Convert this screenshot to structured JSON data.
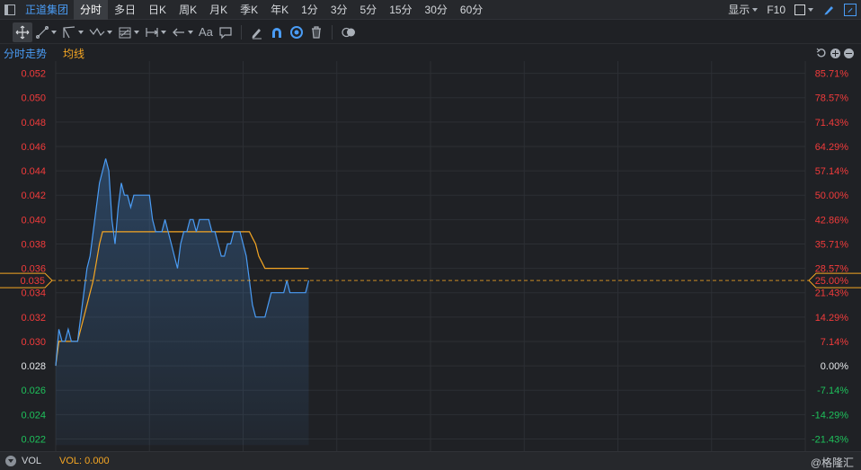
{
  "topbar": {
    "stock_name": "正道集团",
    "tabs": [
      "分时",
      "多日",
      "日K",
      "周K",
      "月K",
      "季K",
      "年K",
      "1分",
      "3分",
      "5分",
      "15分",
      "30分",
      "60分"
    ],
    "active_tab": 0,
    "display_label": "显示",
    "f10_label": "F10"
  },
  "toolbar": {
    "text_tool_label": "Aa"
  },
  "chart_head": {
    "time_share_label": "分时走势",
    "avg_label": "均线"
  },
  "colors": {
    "up": "#f23b3b",
    "down": "#1ec15b",
    "price_line": "#4a9cf5",
    "avg_line": "#f5a623",
    "accent": "#4a9cf5"
  },
  "chart_data": {
    "type": "line",
    "prev_close": 0.028,
    "current_price": "0.035",
    "current_pct": "25.00%",
    "ylim": [
      0.021,
      0.053
    ],
    "left_ticks": [
      "0.052",
      "0.050",
      "0.048",
      "0.046",
      "0.044",
      "0.042",
      "0.040",
      "0.038",
      "0.036",
      "0.034",
      "0.032",
      "0.030",
      "0.028",
      "0.026",
      "0.024",
      "0.022"
    ],
    "right_ticks": [
      "85.71%",
      "78.57%",
      "71.43%",
      "64.29%",
      "57.14%",
      "50.00%",
      "42.86%",
      "35.71%",
      "28.57%",
      "21.43%",
      "14.29%",
      "7.14%",
      "0.00%",
      "-7.14%",
      "-14.29%",
      "-21.43%"
    ],
    "total_minutes": 240,
    "series": [
      {
        "name": "分时走势",
        "values": [
          0.028,
          0.031,
          0.03,
          0.03,
          0.031,
          0.03,
          0.03,
          0.03,
          0.032,
          0.034,
          0.036,
          0.037,
          0.039,
          0.041,
          0.043,
          0.044,
          0.045,
          0.044,
          0.04,
          0.038,
          0.041,
          0.043,
          0.042,
          0.042,
          0.041,
          0.042,
          0.042,
          0.042,
          0.042,
          0.042,
          0.042,
          0.04,
          0.039,
          0.039,
          0.039,
          0.04,
          0.039,
          0.038,
          0.037,
          0.036,
          0.038,
          0.039,
          0.039,
          0.04,
          0.04,
          0.039,
          0.04,
          0.04,
          0.04,
          0.04,
          0.039,
          0.039,
          0.038,
          0.037,
          0.037,
          0.038,
          0.038,
          0.039,
          0.039,
          0.039,
          0.038,
          0.037,
          0.035,
          0.033,
          0.032,
          0.032,
          0.032,
          0.032,
          0.033,
          0.034,
          0.034,
          0.034,
          0.034,
          0.034,
          0.035,
          0.034,
          0.034,
          0.034,
          0.034,
          0.034,
          0.034,
          0.035
        ]
      },
      {
        "name": "均线",
        "values": [
          0.028,
          0.03,
          0.03,
          0.03,
          0.03,
          0.03,
          0.03,
          0.03,
          0.031,
          0.032,
          0.033,
          0.034,
          0.035,
          0.0365,
          0.038,
          0.039,
          0.039,
          0.039,
          0.039,
          0.039,
          0.039,
          0.039,
          0.039,
          0.039,
          0.039,
          0.039,
          0.039,
          0.039,
          0.039,
          0.039,
          0.039,
          0.039,
          0.039,
          0.039,
          0.039,
          0.039,
          0.039,
          0.039,
          0.039,
          0.039,
          0.039,
          0.039,
          0.039,
          0.039,
          0.039,
          0.039,
          0.039,
          0.039,
          0.039,
          0.039,
          0.039,
          0.039,
          0.039,
          0.039,
          0.039,
          0.039,
          0.039,
          0.039,
          0.039,
          0.039,
          0.039,
          0.039,
          0.039,
          0.0385,
          0.038,
          0.037,
          0.0365,
          0.036,
          0.036,
          0.036,
          0.036,
          0.036,
          0.036,
          0.036,
          0.036,
          0.036,
          0.036,
          0.036,
          0.036,
          0.036,
          0.036,
          0.036
        ]
      }
    ],
    "grid": true
  },
  "footer": {
    "vol_label": "VOL",
    "vol_value": "VOL: 0.000",
    "watermark": "@格隆汇"
  }
}
